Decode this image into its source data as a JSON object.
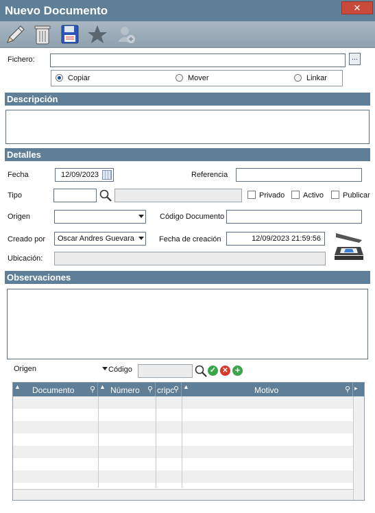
{
  "window": {
    "title": "Nuevo Documento",
    "close_glyph": "✕"
  },
  "toolbar": {
    "icons": [
      "pencil-icon",
      "trash-icon",
      "save-disk-icon",
      "star-icon",
      "add-user-icon"
    ]
  },
  "fichero": {
    "label": "Fichero:",
    "value": "",
    "browse_label": "...",
    "options": [
      {
        "label": "Copiar",
        "selected": true
      },
      {
        "label": "Mover",
        "selected": false
      },
      {
        "label": "Linkar",
        "selected": false
      }
    ]
  },
  "descripcion": {
    "header": "Descripción",
    "value": ""
  },
  "detalles": {
    "header": "Detalles",
    "fecha_label": "Fecha",
    "fecha_value": "12/09/2023",
    "referencia_label": "Referencia",
    "referencia_value": "",
    "tipo_label": "Tipo",
    "tipo_code": "",
    "tipo_desc": "",
    "privado_label": "Privado",
    "activo_label": "Activo",
    "publicar_label": "Publicar",
    "origen_label": "Origen",
    "origen_value": "",
    "codigo_doc_label": "Código Documento",
    "codigo_doc_value": "",
    "creado_por_label": "Creado por",
    "creado_por_value": "Oscar Andres Guevara",
    "fecha_creacion_label": "Fecha de creación",
    "fecha_creacion_value": "12/09/2023 21:59:56",
    "ubicacion_label": "Ubicación:",
    "ubicacion_value": ""
  },
  "observaciones": {
    "header": "Observaciones",
    "value": ""
  },
  "filter": {
    "origen_label": "Origen",
    "codigo_label": "Código",
    "codigo_value": ""
  },
  "grid": {
    "columns": [
      "Documento",
      "Número",
      "cripc",
      "Motivo"
    ],
    "rows": 8
  },
  "colors": {
    "header_blue": "#5f7f98",
    "close_red": "#c94a3b",
    "ok_green": "#3aa64a",
    "cancel_red": "#d83a2e"
  }
}
